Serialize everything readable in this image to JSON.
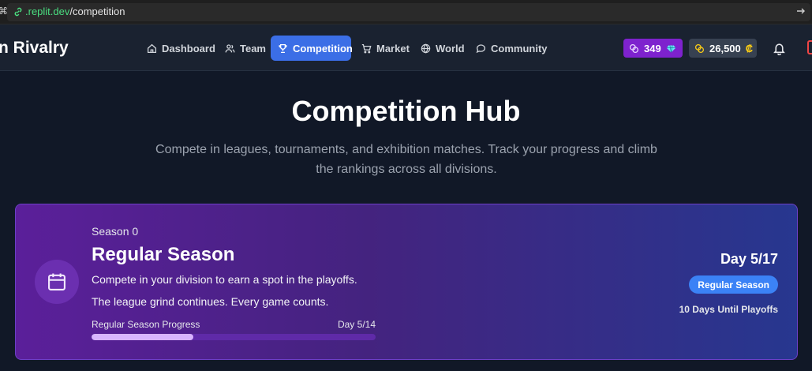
{
  "browser": {
    "url_domain": ".replit.dev",
    "url_path": "/competition"
  },
  "nav": {
    "brand": "n Rivalry",
    "items": [
      {
        "label": "Dashboard",
        "icon": "home-icon"
      },
      {
        "label": "Team",
        "icon": "users-icon"
      },
      {
        "label": "Competition",
        "icon": "trophy-icon",
        "active": true
      },
      {
        "label": "Market",
        "icon": "cart-icon"
      },
      {
        "label": "World",
        "icon": "globe-icon"
      },
      {
        "label": "Community",
        "icon": "chat-icon"
      }
    ],
    "gems": "349",
    "credits": "26,500",
    "credits_symbol": "₡"
  },
  "hero": {
    "title": "Competition Hub",
    "subtitle": "Compete in leagues, tournaments, and exhibition matches. Track your progress and climb the rankings across all divisions."
  },
  "season": {
    "label": "Season 0",
    "title": "Regular Season",
    "desc1": "Compete in your division to earn a spot in the playoffs.",
    "desc2": "The league grind continues. Every game counts.",
    "progress_label": "Regular Season Progress",
    "progress_day": "Day 5/14",
    "progress_fraction": 0.357,
    "day_display": "Day 5/17",
    "phase_badge": "Regular Season",
    "until_playoffs": "10 Days Until Playoffs"
  },
  "colors": {
    "accent_blue": "#3b6ee6",
    "gems_purple": "#7e22ce",
    "badge_blue": "#3b82f6",
    "progress_fill": "#d8b4fe"
  }
}
